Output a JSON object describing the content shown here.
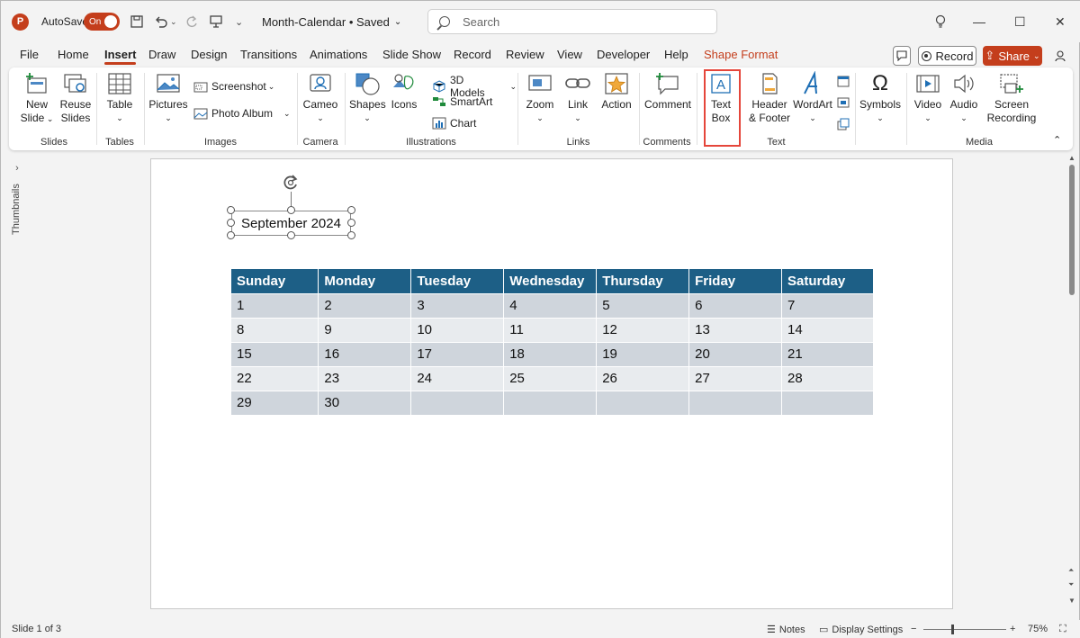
{
  "titlebar": {
    "app_icon": "P",
    "autosave_label": "AutoSave",
    "autosave_state": "On",
    "doc_title": "Month-Calendar • Saved",
    "search_placeholder": "Search"
  },
  "menu": {
    "tabs": [
      "File",
      "Home",
      "Insert",
      "Draw",
      "Design",
      "Transitions",
      "Animations",
      "Slide Show",
      "Record",
      "Review",
      "View",
      "Developer",
      "Help",
      "Shape Format"
    ],
    "active_tab": "Insert",
    "record_label": "Record",
    "share_label": "Share"
  },
  "ribbon": {
    "groups": {
      "slides": "Slides",
      "tables": "Tables",
      "images": "Images",
      "camera": "Camera",
      "illustrations": "Illustrations",
      "links": "Links",
      "comments": "Comments",
      "text": "Text",
      "media": "Media"
    },
    "buttons": {
      "new_slide": "New Slide",
      "reuse_slides": "Reuse Slides",
      "table": "Table",
      "pictures": "Pictures",
      "screenshot": "Screenshot",
      "photo_album": "Photo Album",
      "cameo": "Cameo",
      "shapes": "Shapes",
      "icons": "Icons",
      "models_3d": "3D Models",
      "smartart": "SmartArt",
      "chart": "Chart",
      "zoom": "Zoom",
      "link": "Link",
      "action": "Action",
      "comment": "Comment",
      "text_box": "Text Box",
      "header_footer": "Header & Footer",
      "wordart": "WordArt",
      "symbols": "Symbols",
      "video": "Video",
      "audio": "Audio",
      "screen_recording": "Screen Recording"
    }
  },
  "sidebar": {
    "label": "Thumbnails"
  },
  "slide": {
    "textbox": "September 2024",
    "calendar": {
      "headers": [
        "Sunday",
        "Monday",
        "Tuesday",
        "Wednesday",
        "Thursday",
        "Friday",
        "Saturday"
      ],
      "rows": [
        [
          "1",
          "2",
          "3",
          "4",
          "5",
          "6",
          "7"
        ],
        [
          "8",
          "9",
          "10",
          "11",
          "12",
          "13",
          "14"
        ],
        [
          "15",
          "16",
          "17",
          "18",
          "19",
          "20",
          "21"
        ],
        [
          "22",
          "23",
          "24",
          "25",
          "26",
          "27",
          "28"
        ],
        [
          "29",
          "30",
          "",
          "",
          "",
          "",
          ""
        ]
      ]
    }
  },
  "status": {
    "slide_info": "Slide 1 of 3",
    "notes": "Notes",
    "display_settings": "Display Settings",
    "zoom": "75%"
  },
  "colors": {
    "accent": "#c43e1c",
    "table_header": "#1d5f86",
    "highlight": "#e5463b"
  }
}
